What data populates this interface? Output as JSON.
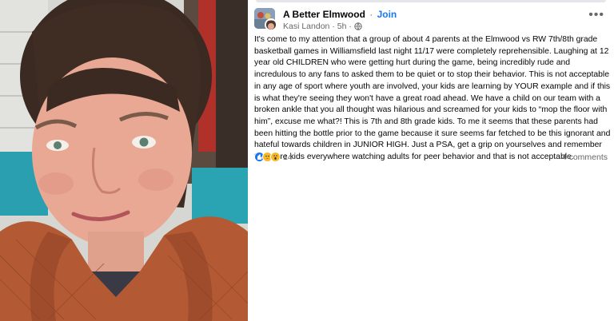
{
  "post": {
    "group_name": "A Better Elmwood",
    "separator": "·",
    "join_label": "Join",
    "author": "Kasi Landon",
    "time": "5h",
    "more_icon": "ellipsis-icon",
    "privacy_icon": "globe-icon",
    "body": "It's come to my attention that a group of about 4 parents at the Elmwood vs RW 7th/8th grade basketball games in Williamsfield last night 11/17 were completely reprehensible. Laughing at 12 year old CHILDREN who were getting hurt during the game, being incredibly rude and incredulous to any fans to asked them to be quiet or to stop their behavior. This is not acceptable in any age of sport where youth are involved, your kids are learning by YOUR example and if this is what they're seeing they won't have a great road ahead. We have a child on our team with a broken ankle that you all thought was hilarious and screamed for your kids to “mop the floor with him”, excuse me what?! This is 7th and 8th grade kids. To me it seems that these parents had been hitting the bottle prior to the game because it sure seems far fetched to be this ignorant and hateful towards children in JUNIOR HIGH. Just a PSA, get a grip on yourselves and remember there are kids everywhere watching adults for peer behavior and that is not acceptable.",
    "reactions": {
      "icons": [
        "like-icon",
        "care-icon",
        "wow-icon"
      ],
      "count": "14"
    },
    "comments_label": "4 comments"
  },
  "colors": {
    "accent": "#1877f2",
    "secondary_text": "#65676b",
    "primary_text": "#050505"
  }
}
